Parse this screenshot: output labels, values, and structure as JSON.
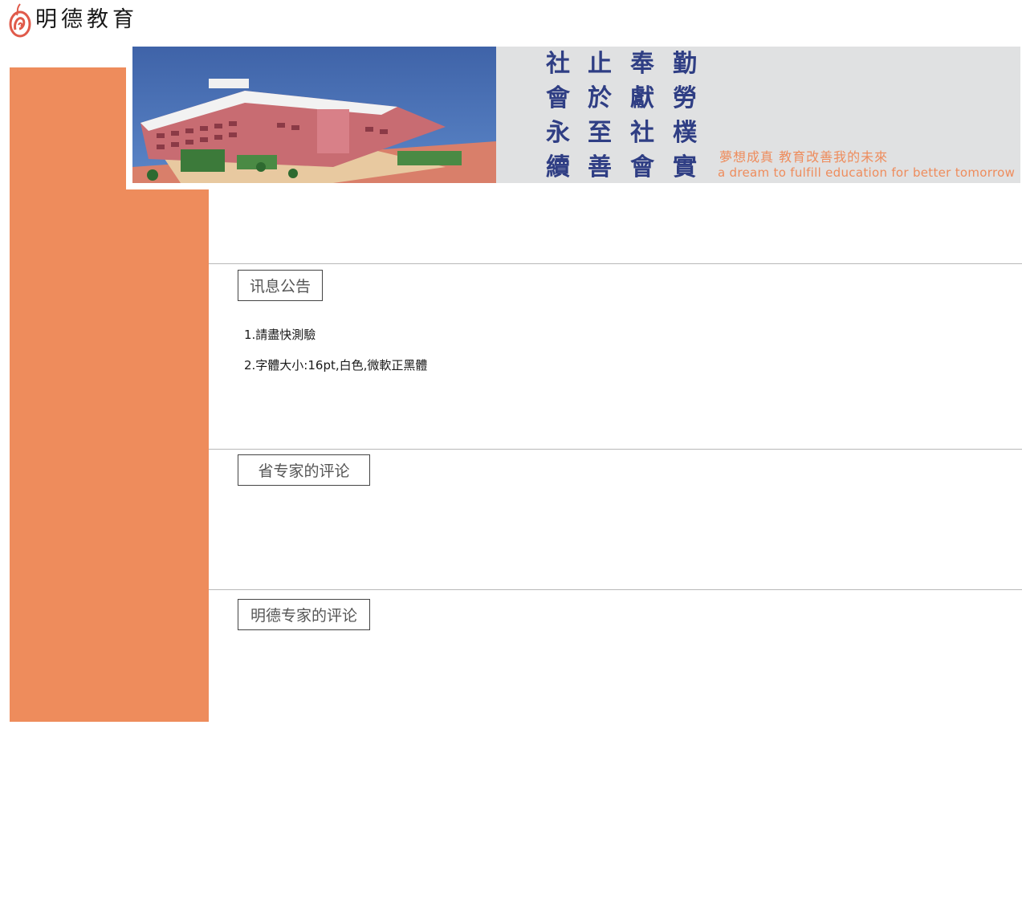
{
  "logo": {
    "text": "明德教育",
    "icon": "flame-swirl-icon",
    "icon_color": "#e05a4a"
  },
  "banner": {
    "photo_alt": "school campus building",
    "motto_columns": [
      [
        "勤",
        "勞",
        "樸",
        "實"
      ],
      [
        "奉",
        "獻",
        "社",
        "會"
      ],
      [
        "止",
        "於",
        "至",
        "善"
      ],
      [
        "社",
        "會",
        "永",
        "續"
      ]
    ],
    "slogan_cn": "夢想成真 教育改善我的未來",
    "slogan_en": "a dream to fulfill education for better tomorrow"
  },
  "sections": [
    {
      "title": "讯息公告",
      "items": [
        "1.請盡快測驗",
        "2.字體大小:16pt,白色,微軟正黑體"
      ]
    },
    {
      "title": "省专家的评论",
      "items": []
    },
    {
      "title": "明德专家的评论",
      "items": []
    }
  ],
  "colors": {
    "sidebar": "#ee8c5c",
    "motto": "#2f3e84",
    "slogan": "#ee8c5c",
    "banner_bg": "#e0e1e2"
  }
}
